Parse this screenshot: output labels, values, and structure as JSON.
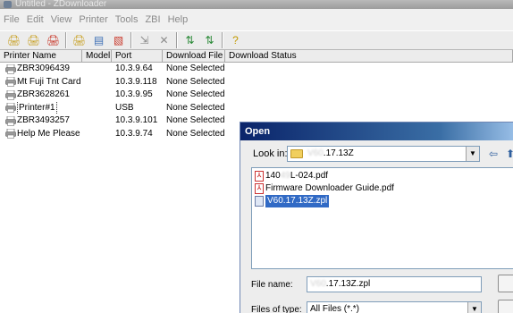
{
  "window": {
    "title": "Untitled - ZDownloader"
  },
  "menu": [
    "File",
    "Edit",
    "View",
    "Printer",
    "Tools",
    "ZBI",
    "Help"
  ],
  "toolbar": {
    "groups": [
      [
        {
          "icon": "add-printer-icon",
          "glyph": "🖨"
        },
        {
          "icon": "edit-printer-icon",
          "glyph": "🖨"
        },
        {
          "icon": "remove-printer-icon",
          "glyph": "🖨"
        }
      ],
      [
        {
          "icon": "printer-settings-icon",
          "glyph": "🖨"
        },
        {
          "icon": "add-file-icon",
          "glyph": "▤"
        },
        {
          "icon": "remove-file-icon",
          "glyph": "▧"
        }
      ],
      [
        {
          "icon": "download-icon",
          "glyph": "⇲"
        },
        {
          "icon": "cancel-download-icon",
          "glyph": "✕"
        }
      ],
      [
        {
          "icon": "ping-icon",
          "glyph": "⇅"
        },
        {
          "icon": "ping-all-icon",
          "glyph": "⇅"
        }
      ],
      [
        {
          "icon": "help-icon",
          "glyph": "?"
        }
      ]
    ]
  },
  "grid": {
    "columns": [
      "Printer Name",
      "Model",
      "Port",
      "Download File",
      "Download Status"
    ],
    "rows": [
      {
        "name": "ZBR3096439",
        "model": "",
        "port": "10.3.9.64",
        "file": "None Selected",
        "status": "",
        "selected": false
      },
      {
        "name": "Mt Fuji Tnt Card",
        "model": "",
        "port": "10.3.9.118",
        "file": "None Selected",
        "status": "",
        "selected": false
      },
      {
        "name": "ZBR3628261",
        "model": "",
        "port": "10.3.9.95",
        "file": "None Selected",
        "status": "",
        "selected": false
      },
      {
        "name": "Printer#1",
        "model": "",
        "port": "USB",
        "file": "None Selected",
        "status": "",
        "selected": true
      },
      {
        "name": "ZBR3493257",
        "model": "",
        "port": "10.3.9.101",
        "file": "None Selected",
        "status": "",
        "selected": false
      },
      {
        "name": "Help Me Please",
        "model": "",
        "port": "10.3.9.74",
        "file": "None Selected",
        "status": "",
        "selected": false
      }
    ]
  },
  "dialog": {
    "title": "Open",
    "look_in_label": "Look in:",
    "look_in_prefix": "V60",
    "look_in_suffix": ".17.13Z",
    "files": [
      {
        "type": "pdf",
        "prefix": "140",
        "mid": "49",
        "suffix": "L-024.pdf",
        "selected": false
      },
      {
        "type": "pdf",
        "prefix": "",
        "mid": "",
        "suffix": "Firmware Downloader Guide.pdf",
        "selected": false
      },
      {
        "type": "zpl",
        "prefix": "V60",
        "mid": "",
        "suffix": ".17.13Z.zpl",
        "selected": true
      }
    ],
    "file_name_label": "File name:",
    "file_name_prefix": "V60",
    "file_name_suffix": ".17.13Z.zpl",
    "file_type_label": "Files of type:",
    "file_type_value": "All Files (*.*)"
  }
}
